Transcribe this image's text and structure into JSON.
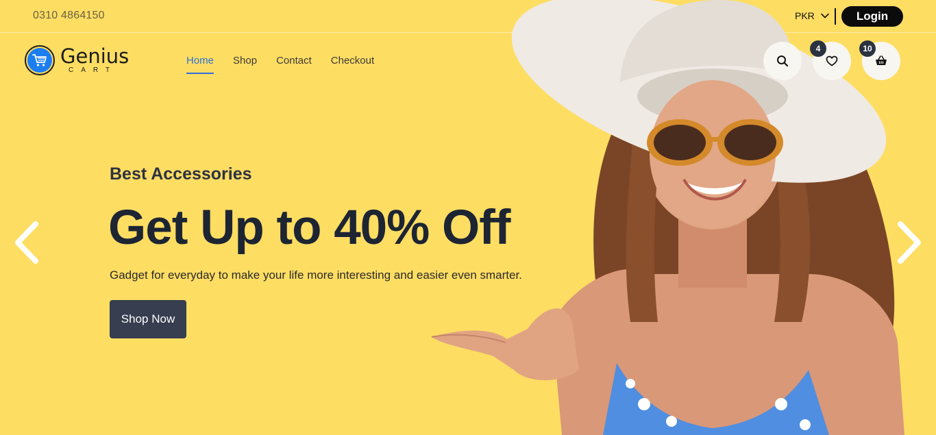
{
  "topbar": {
    "phone": "0310 4864150",
    "currency": "PKR",
    "login_label": "Login"
  },
  "logo": {
    "name": "Genius",
    "sub": "CART"
  },
  "nav": {
    "items": [
      {
        "label": "Home",
        "active": true
      },
      {
        "label": "Shop"
      },
      {
        "label": "Contact"
      },
      {
        "label": "Checkout"
      }
    ]
  },
  "actions": {
    "search_icon": "search-icon",
    "wishlist_count": "4",
    "cart_count": "10"
  },
  "hero": {
    "subtitle": "Best Accessories",
    "title": "Get Up to 40% Off",
    "description": "Gadget for everyday to make your life more interesting and easier even smarter.",
    "cta_label": "Shop Now"
  },
  "colors": {
    "background": "#fedd63",
    "nav_active": "#2f6fd6",
    "button_dark": "#363e50",
    "login_bg": "#0b0b0b"
  }
}
